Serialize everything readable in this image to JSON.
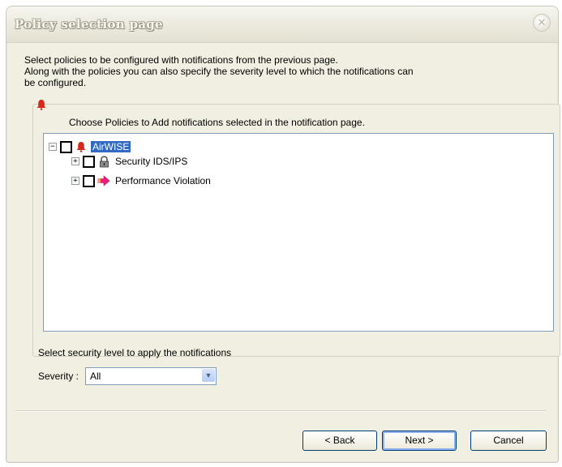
{
  "window": {
    "title": "Policy selection page"
  },
  "intro": {
    "line1": "Select policies to be configured with notifications from the previous page.",
    "line2": "Along with the policies you can also specify the severity level to which the notifications can",
    "line3": "be configured."
  },
  "group": {
    "choose_label": "Choose Policies to Add notifications selected in the notification page."
  },
  "tree": {
    "root": {
      "label": "AirWISE",
      "expander": "−",
      "icon": "bell-icon",
      "selected": true
    },
    "children": [
      {
        "label": "Security IDS/IPS",
        "expander": "+",
        "icon": "lock-icon"
      },
      {
        "label": "Performance Violation",
        "expander": "+",
        "icon": "arrow-right-icon"
      }
    ]
  },
  "severity": {
    "section_label": "Select security level to apply the notifications",
    "caption": "Severity :",
    "value": "All",
    "dropdown_icon": "chevron-down-icon"
  },
  "buttons": {
    "back": "< Back",
    "next": "Next >",
    "cancel": "Cancel"
  },
  "colors": {
    "selection": "#316ac5",
    "dialog_bg": "#f1efe2",
    "button_border": "#003c74",
    "bell_red": "#d42a1e",
    "arrow_pink": "#e8207a"
  }
}
